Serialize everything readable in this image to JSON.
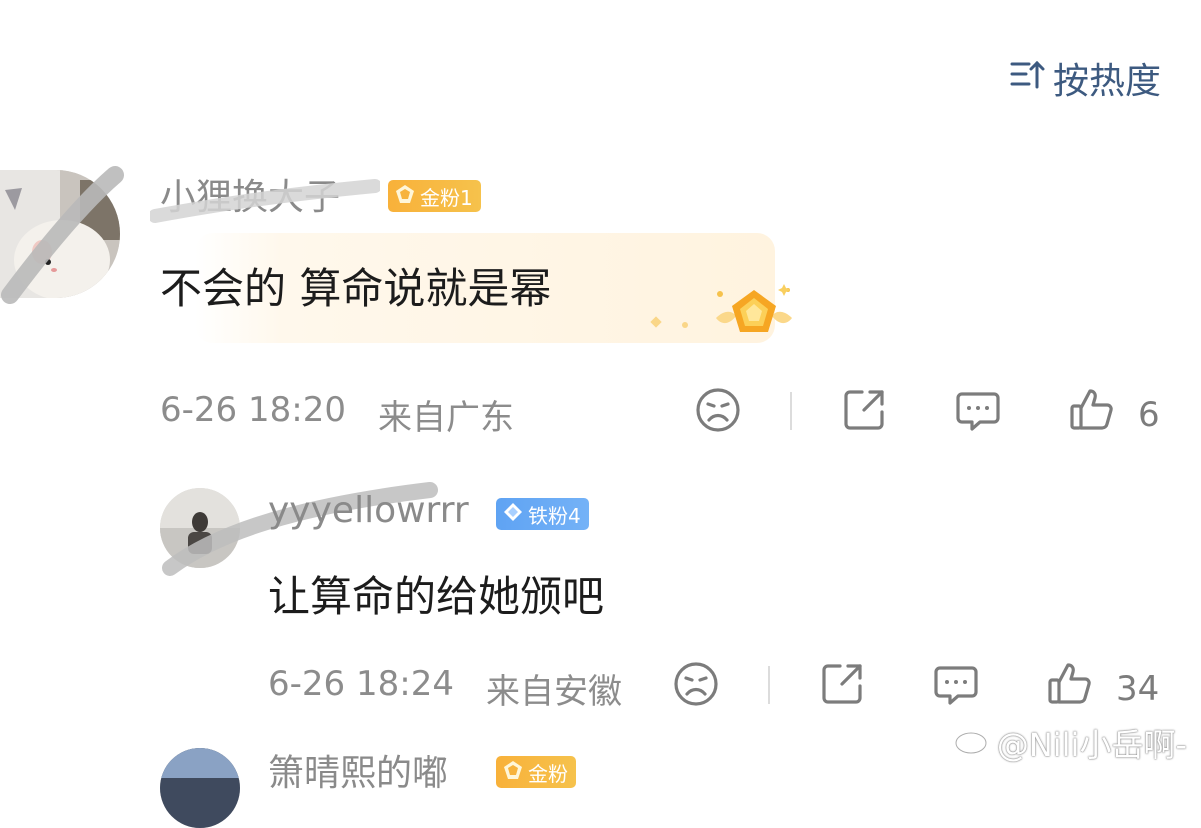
{
  "sort": {
    "label": "按热度",
    "icon": "sort-icon"
  },
  "comments": [
    {
      "username": "小狸换大子",
      "badge": {
        "label": "金粉1",
        "type": "gold"
      },
      "text": "不会的  算命说就是幂",
      "time": "6-26 18:20",
      "location": "来自广东",
      "likes": "6"
    },
    {
      "username": "yyyellowrrr",
      "badge": {
        "label": "铁粉4",
        "type": "iron"
      },
      "text": "让算命的给她颁吧",
      "time": "6-26 18:24",
      "location": "来自安徽",
      "likes": "34"
    },
    {
      "username": "箫晴熙的嘟",
      "badge": {
        "label": "金粉",
        "type": "gold"
      }
    }
  ],
  "watermark": "@Nili小岳啊-",
  "colors": {
    "accent": "#3d5a80",
    "gold_badge": "#f8b13a",
    "iron_badge": "#5fa3f3",
    "meta": "#8c8c8c"
  }
}
